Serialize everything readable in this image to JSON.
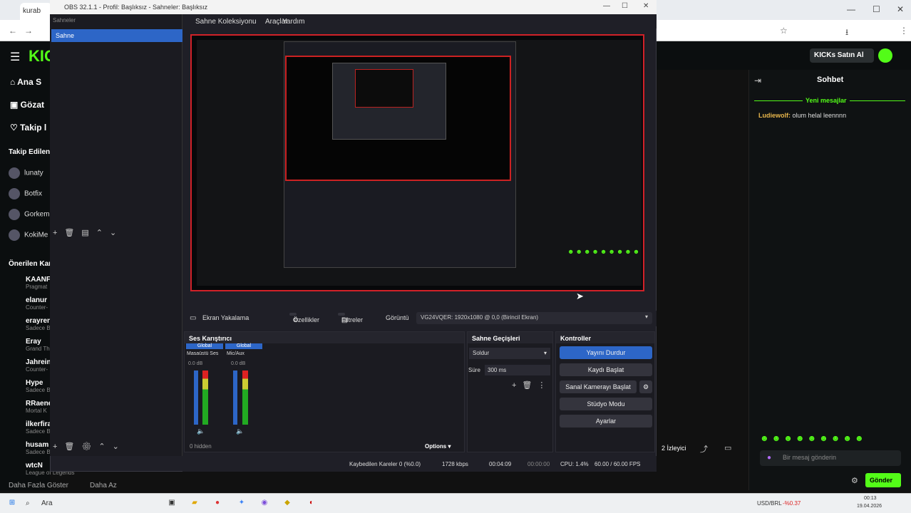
{
  "browser": {
    "tab_label": "kurab",
    "window_controls": [
      "—",
      "☐",
      "✕"
    ]
  },
  "kick": {
    "nav": [
      "Ana S",
      "Gözat",
      "Takip l"
    ],
    "followed_header": "Takip Edilen",
    "followed": [
      "lunaty",
      "Botfix",
      "Gorkem",
      "KokiMe"
    ],
    "recommended_header": "Önerilen Kan",
    "channels": [
      {
        "name": "KAANF",
        "sub": "Pragmat"
      },
      {
        "name": "elanur",
        "sub": "Counter-"
      },
      {
        "name": "erayren",
        "sub": "Sadece B"
      },
      {
        "name": "Eray",
        "sub": "Grand Th"
      },
      {
        "name": "Jahrein",
        "sub": "Counter-"
      },
      {
        "name": "Hype",
        "sub": "Sadece B"
      },
      {
        "name": "RRaene",
        "sub": "Mortal K"
      },
      {
        "name": "ilkerfira",
        "sub": "Sadece B"
      },
      {
        "name": "husam",
        "sub": "Sadece B"
      },
      {
        "name": "wtcN",
        "sub": "League of Legends"
      }
    ],
    "more_label": "Daha Fazla Göster",
    "less_label": "Daha Az",
    "kicks_button": "KICKs Satın Al",
    "chat": {
      "title": "Sohbet",
      "new_messages": "Yeni mesajlar",
      "msg_user": "Ludiewolf:",
      "msg_text": "olum helal leennnn",
      "input_placeholder": "Bir mesaj gönderin",
      "send": "Gönder",
      "viewers": "2 İzleyici"
    }
  },
  "obs": {
    "title": "OBS 32.1.1 - Profil: Başlıksız - Sahneler: Başlıksız",
    "menu": [
      "Sahne Koleksiyonu",
      "Araçlar",
      "Yardım"
    ],
    "scenes_header": "Sahneler",
    "scene_selected": "Sahne",
    "source_label": "Ekran Yakalama",
    "properties": "Özellikler",
    "filters": "Filtreler",
    "display_label": "Görüntü",
    "display_value": "VG24VQER: 1920x1080 @ 0,0 (Birincil Ekran)",
    "audio_mixer": "Ses Karıştırıcı",
    "global": "Global",
    "desktop_audio": "Masaüstü Ses",
    "mic_aux": "Mic/Aux",
    "db_value": "0.0 dB",
    "hidden": "0 hidden",
    "options": "Options",
    "transitions": "Sahne Geçişleri",
    "transition_value": "Soldur",
    "duration_label": "Süre",
    "duration_value": "300 ms",
    "controls": "Kontroller",
    "stop_stream": "Yayını Durdur",
    "start_record": "Kaydı Başlat",
    "start_vcam": "Sanal Kamerayı Başlat",
    "studio_mode": "Stüdyo Modu",
    "settings": "Ayarlar",
    "dropped_frames": "Kaybedilen Kareler 0 (%0.0)",
    "bitrate": "1728 kbps",
    "stream_time": "00:04:09",
    "rec_time": "00:00:00",
    "cpu": "CPU: 1.4%",
    "fps": "60.00 / 60.00 FPS"
  },
  "taskbar": {
    "search": "Ara",
    "currency": "USD/BRL",
    "change": "-%0.37",
    "time": "00:13",
    "date": "19.04.2026"
  }
}
